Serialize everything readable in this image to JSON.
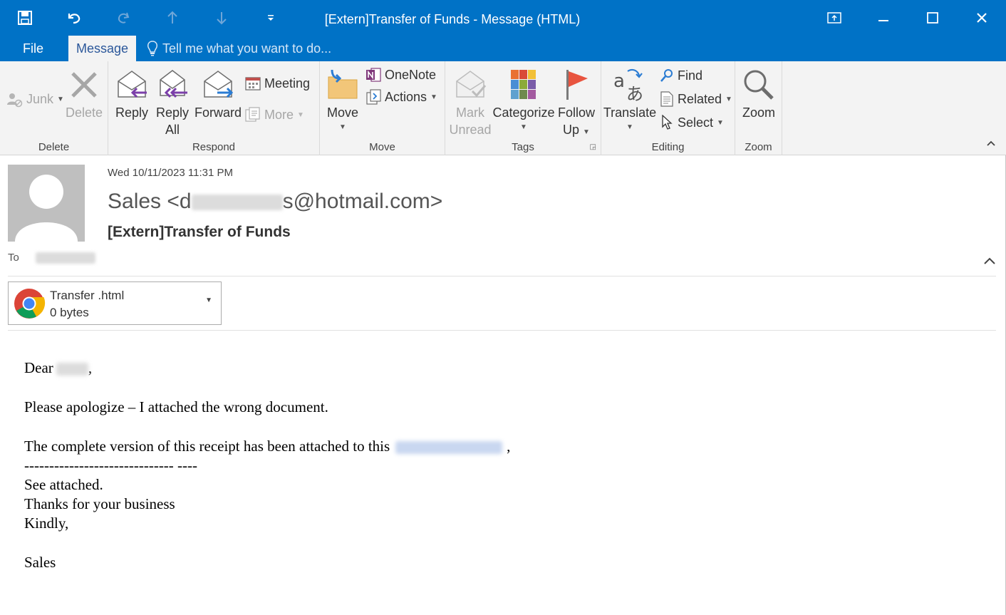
{
  "window": {
    "title": "[Extern]Transfer of Funds - Message (HTML)"
  },
  "tabs": {
    "file": "File",
    "message": "Message",
    "tell_me": "Tell me what you want to do..."
  },
  "ribbon": {
    "delete_group": {
      "label": "Delete",
      "junk": "Junk",
      "delete": "Delete"
    },
    "respond_group": {
      "label": "Respond",
      "reply": "Reply",
      "reply_all_1": "Reply",
      "reply_all_2": "All",
      "forward": "Forward",
      "meeting": "Meeting",
      "more": "More"
    },
    "move_group": {
      "label": "Move",
      "move": "Move",
      "onenote": "OneNote",
      "actions": "Actions"
    },
    "tags_group": {
      "label": "Tags",
      "mark_unread_1": "Mark",
      "mark_unread_2": "Unread",
      "categorize": "Categorize",
      "follow_up_1": "Follow",
      "follow_up_2": "Up"
    },
    "editing_group": {
      "label": "Editing",
      "translate": "Translate",
      "find": "Find",
      "related": "Related",
      "select": "Select"
    },
    "zoom_group": {
      "label": "Zoom",
      "zoom": "Zoom"
    }
  },
  "message": {
    "sent": "Wed 10/11/2023 11:31 PM",
    "sender_prefix": "Sales <d",
    "sender_suffix": "s@hotmail.com>",
    "subject": "[Extern]Transfer of Funds",
    "to_label": "To"
  },
  "attachment": {
    "name": "Transfer .html",
    "size": "0 bytes"
  },
  "body": {
    "greeting": "Dear",
    "greeting_end": ",",
    "line1": "Please apologize – I attached the wrong document.",
    "line2_prefix": "The complete version of this receipt has been attached to this",
    "line2_suffix": ",",
    "divider": "------------------------------ ----",
    "line3": "See attached.",
    "line4": "Thanks for your business",
    "line5": "Kindly,",
    "signature": "Sales"
  },
  "colors": {
    "accent": "#0072c6",
    "ribbon_bg": "#f3f3f3",
    "tab_active_text": "#2b579a"
  }
}
